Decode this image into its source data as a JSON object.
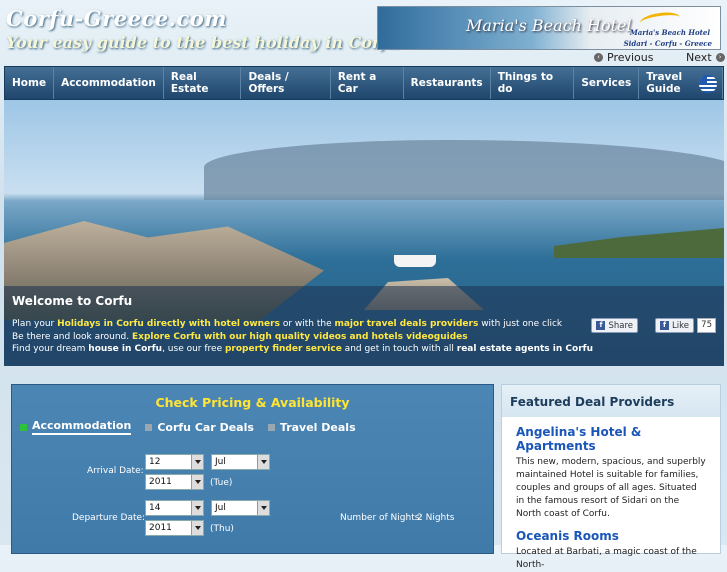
{
  "site": {
    "logo_title": "Corfu-Greece.com",
    "logo_tagline": "Your easy guide to the best holiday in Corfu"
  },
  "banner": {
    "title": "Maria's Beach Hotel",
    "subtitle1": "Maria's Beach Hotel",
    "subtitle2": "Sidari - Corfu - Greece",
    "prev": "Previous",
    "next": "Next"
  },
  "nav": [
    "Home",
    "Accommodation",
    "Real Estate",
    "Deals / Offers",
    "Rent a Car",
    "Restaurants",
    "Things to do",
    "Services",
    "Travel Guide"
  ],
  "welcome": {
    "title": "Welcome to Corfu",
    "l1a": "Plan your ",
    "l1b": "Holidays in Corfu directly with hotel owners",
    "l1c": " or with the ",
    "l1d": "major travel deals providers",
    "l1e": " with just one click",
    "l2a": "Be there and look around. ",
    "l2b": "Explore Corfu with our high quality videos and hotels videoguides",
    "l3a": "Find your dream ",
    "l3b": "house in Corfu",
    "l3c": ", use our free ",
    "l3d": "property finder service",
    "l3e": " and get in touch with all ",
    "l3f": "real estate agents in Corfu",
    "share": "Share",
    "like": "Like",
    "like_count": "75"
  },
  "check": {
    "title": "Check Pricing & Availability",
    "tabs": [
      "Accommodation",
      "Corfu Car Deals",
      "Travel Deals"
    ],
    "arrival_label": "Arrival Date:",
    "arrival_day": "12",
    "arrival_month": "Jul",
    "arrival_year": "2011",
    "arrival_dow": "(Tue)",
    "departure_label": "Departure Date:",
    "departure_day": "14",
    "departure_month": "Jul",
    "departure_year": "2011",
    "departure_dow": "(Thu)",
    "nights_label": "Number of Nights:",
    "nights_value": "2 Nights"
  },
  "featured": {
    "title": "Featured Deal Providers",
    "items": [
      {
        "name": "Angelina's Hotel & Apartments",
        "desc": "This new, modern, spacious, and superbly maintained Hotel is suitable for families, couples and groups of all ages. Situated in the famous resort of Sidari on the North coast of Corfu."
      },
      {
        "name": "Oceanis Rooms",
        "desc": "Located at Barbati, a magic coast of the North-"
      }
    ]
  }
}
